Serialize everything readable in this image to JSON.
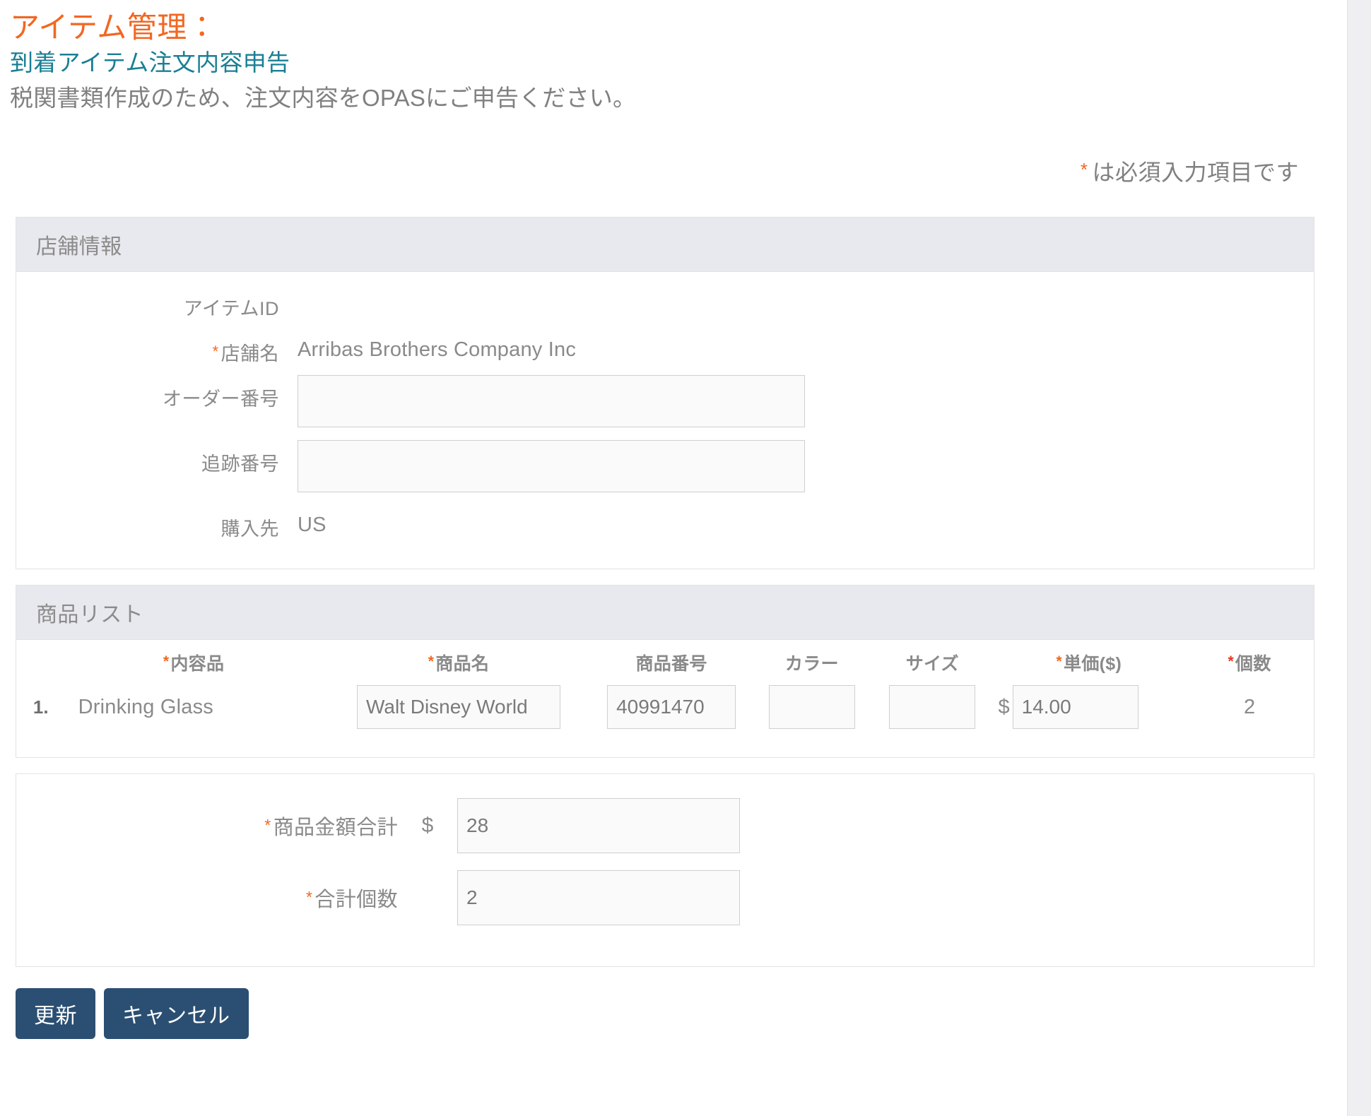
{
  "header": {
    "title_main": "アイテム管理：",
    "title_sub": "到着アイテム注文内容申告",
    "description": "税関書類作成のため、注文内容をOPASにご申告ください。",
    "required_note": "は必須入力項目です",
    "asterisk": "*"
  },
  "colors": {
    "accent_orange": "#f26722",
    "teal": "#1a7f94",
    "label_gray": "#8a8a8a",
    "panel_head_bg": "#e8e9ee",
    "button_navy": "#2b4f72",
    "highlight_border": "#f07d2e",
    "required_red": "#e8361c"
  },
  "store_section": {
    "heading": "店舗情報",
    "fields": [
      {
        "label": "アイテムID",
        "value": "",
        "required": false,
        "type": "static"
      },
      {
        "label": "店舗名",
        "value": "Arribas Brothers Company Inc",
        "required": true,
        "type": "static"
      },
      {
        "label": "オーダー番号",
        "value": "",
        "placeholder": "",
        "required": false,
        "type": "input"
      },
      {
        "label": "追跡番号",
        "value": "",
        "placeholder": "",
        "required": false,
        "type": "input"
      },
      {
        "label": "購入先",
        "value": "US",
        "required": false,
        "type": "static"
      }
    ]
  },
  "product_section": {
    "heading": "商品リスト",
    "columns": [
      {
        "label": "内容品",
        "required": true,
        "star_color": "orange"
      },
      {
        "label": "商品名",
        "required": true,
        "star_color": "orange"
      },
      {
        "label": "商品番号",
        "required": false
      },
      {
        "label": "カラー",
        "required": false
      },
      {
        "label": "サイズ",
        "required": false
      },
      {
        "label": "単価($)",
        "required": true,
        "star_color": "orange"
      },
      {
        "label": "個数",
        "required": true,
        "star_color": "red"
      }
    ],
    "currency_symbol": "$",
    "rows": [
      {
        "index": "1.",
        "content": "Drinking Glass",
        "product_name": "Walt Disney World",
        "product_number": "40991470",
        "color": "",
        "size": "",
        "unit_price": "14.00",
        "quantity": "2"
      }
    ]
  },
  "totals_section": {
    "amount_label": "商品金額合計",
    "amount_currency": "$",
    "amount_value": "28",
    "quantity_label": "合計個数",
    "quantity_value": "2"
  },
  "buttons": {
    "update": "更新",
    "cancel": "キャンセル"
  }
}
